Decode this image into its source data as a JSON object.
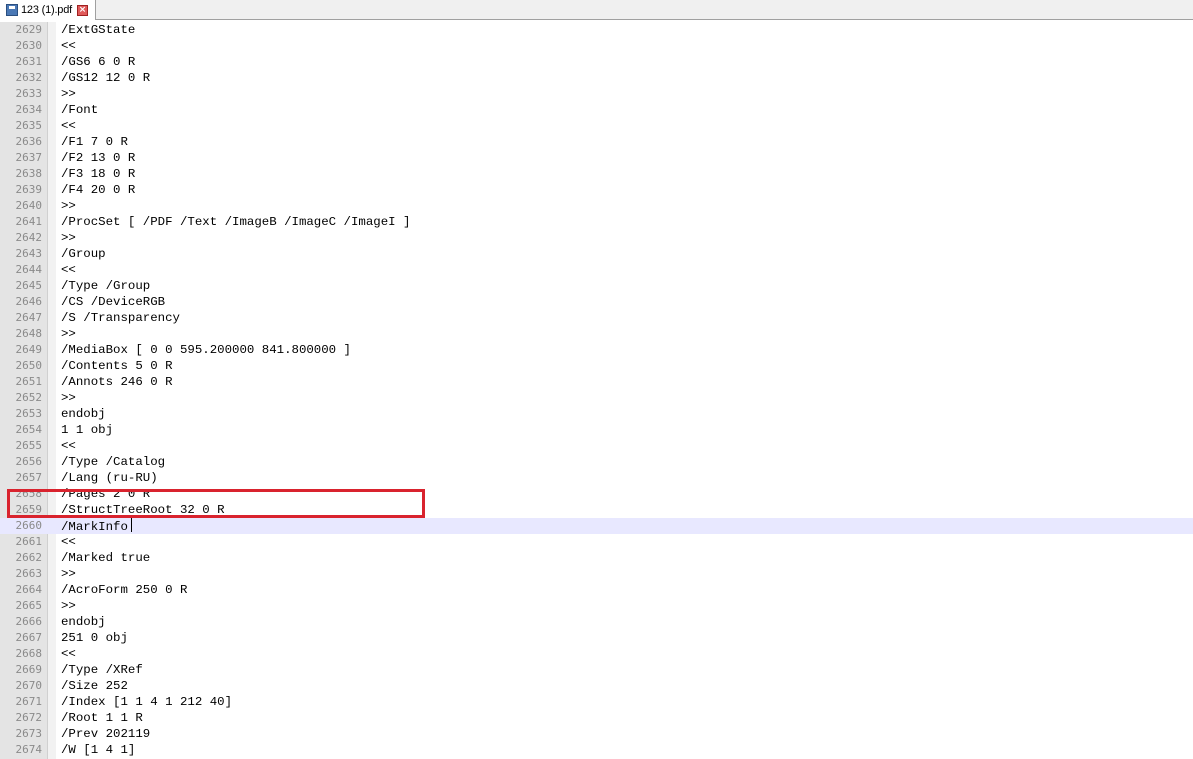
{
  "tab": {
    "title": "123 (1).pdf",
    "icon": "save-disk-icon",
    "close_icon": "close-icon"
  },
  "editor": {
    "current_line": "2660",
    "annotation_color": "#d9232e",
    "current_line_color": "#e8e8ff",
    "lines": [
      {
        "no": "2629",
        "text": "/ExtGState"
      },
      {
        "no": "2630",
        "text": "<<"
      },
      {
        "no": "2631",
        "text": "/GS6 6 0 R"
      },
      {
        "no": "2632",
        "text": "/GS12 12 0 R"
      },
      {
        "no": "2633",
        "text": ">>"
      },
      {
        "no": "2634",
        "text": "/Font"
      },
      {
        "no": "2635",
        "text": "<<"
      },
      {
        "no": "2636",
        "text": "/F1 7 0 R"
      },
      {
        "no": "2637",
        "text": "/F2 13 0 R"
      },
      {
        "no": "2638",
        "text": "/F3 18 0 R"
      },
      {
        "no": "2639",
        "text": "/F4 20 0 R"
      },
      {
        "no": "2640",
        "text": ">>"
      },
      {
        "no": "2641",
        "text": "/ProcSet [ /PDF /Text /ImageB /ImageC /ImageI ]"
      },
      {
        "no": "2642",
        "text": ">>"
      },
      {
        "no": "2643",
        "text": "/Group"
      },
      {
        "no": "2644",
        "text": "<<"
      },
      {
        "no": "2645",
        "text": "/Type /Group"
      },
      {
        "no": "2646",
        "text": "/CS /DeviceRGB"
      },
      {
        "no": "2647",
        "text": "/S /Transparency"
      },
      {
        "no": "2648",
        "text": ">>"
      },
      {
        "no": "2649",
        "text": "/MediaBox [ 0 0 595.200000 841.800000 ]"
      },
      {
        "no": "2650",
        "text": "/Contents 5 0 R"
      },
      {
        "no": "2651",
        "text": "/Annots 246 0 R"
      },
      {
        "no": "2652",
        "text": ">>"
      },
      {
        "no": "2653",
        "text": "endobj"
      },
      {
        "no": "2654",
        "text": "1 1 obj"
      },
      {
        "no": "2655",
        "text": "<<"
      },
      {
        "no": "2656",
        "text": "/Type /Catalog"
      },
      {
        "no": "2657",
        "text": "/Lang (ru-RU)"
      },
      {
        "no": "2658",
        "text": "/Pages 2 0 R"
      },
      {
        "no": "2659",
        "text": "/StructTreeRoot 32 0 R"
      },
      {
        "no": "2660",
        "text": "/MarkInfo"
      },
      {
        "no": "2661",
        "text": "<<"
      },
      {
        "no": "2662",
        "text": "/Marked true"
      },
      {
        "no": "2663",
        "text": ">>"
      },
      {
        "no": "2664",
        "text": "/AcroForm 250 0 R"
      },
      {
        "no": "2665",
        "text": ">>"
      },
      {
        "no": "2666",
        "text": "endobj"
      },
      {
        "no": "2667",
        "text": "251 0 obj"
      },
      {
        "no": "2668",
        "text": "<<"
      },
      {
        "no": "2669",
        "text": "/Type /XRef"
      },
      {
        "no": "2670",
        "text": "/Size 252"
      },
      {
        "no": "2671",
        "text": "/Index [1 1 4 1 212 40]"
      },
      {
        "no": "2672",
        "text": "/Root 1 1 R"
      },
      {
        "no": "2673",
        "text": "/Prev 202119"
      },
      {
        "no": "2674",
        "text": "/W [1 4 1]"
      }
    ]
  }
}
